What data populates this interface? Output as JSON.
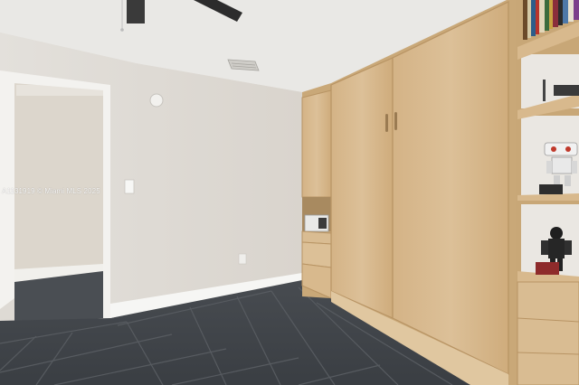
{
  "photo": {
    "watermark": "A1131919 © Miami MLS 2025"
  },
  "colors": {
    "ceiling": "#e9e8e5",
    "wall": "#e0dcd6",
    "hallway_wall": "#dcd6cc",
    "floor_tile": "#3f4348",
    "grout": "#54585d",
    "trim": "#f6f6f4",
    "cabinet_wood": "#d8b98d",
    "cabinet_wood_dark": "#c8a677",
    "fan": "#2c2c2c"
  },
  "objects": [
    "ceiling-fan",
    "hvac-vent-icon",
    "smoke-detector-icon",
    "doorway",
    "light-switch",
    "power-outlet",
    "murphy-bed-cabinet",
    "side-drawers",
    "microwave",
    "open-shelving",
    "books",
    "robot-toy",
    "figurine"
  ]
}
